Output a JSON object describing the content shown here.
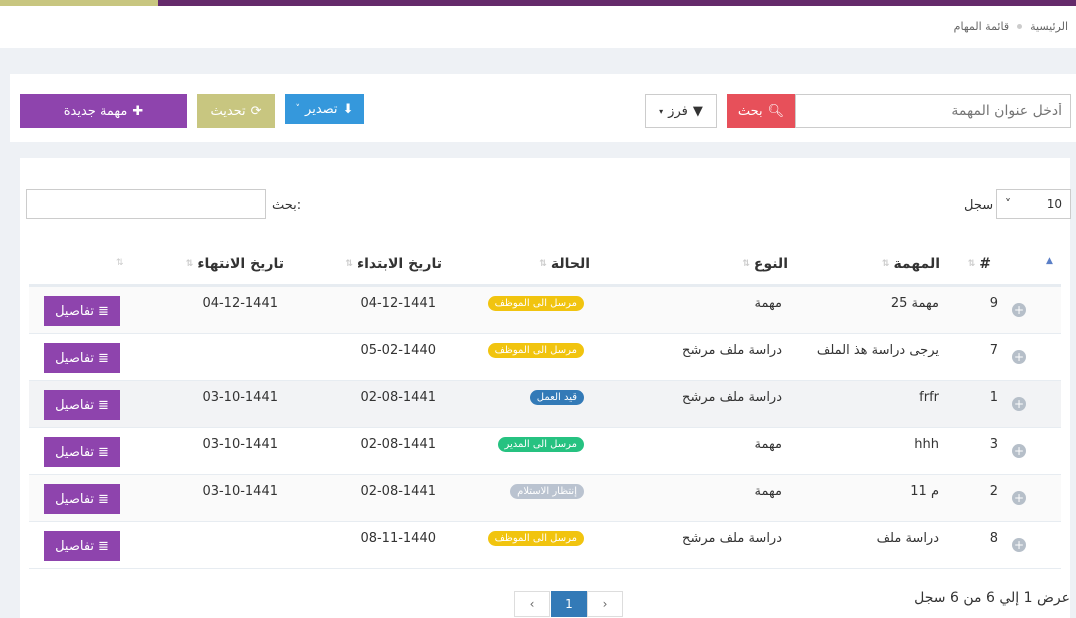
{
  "breadcrumb": [
    "الرئيسية",
    "قائمة المهام"
  ],
  "toolbar": {
    "search_placeholder": "أدخل عنوان المهمة",
    "search_btn": "بحث",
    "sort_btn": "فرز",
    "export_btn": "تصدير",
    "refresh_btn": "تحديث",
    "new_btn": "مهمة جديدة"
  },
  "table_controls": {
    "length_value": "10",
    "length_label": "سجل",
    "search_label": "بحث:"
  },
  "columns": [
    "#",
    "المهمة",
    "النوع",
    "الحالة",
    "تاريخ الابتداء",
    "تاريخ الانتهاء"
  ],
  "details_label": "تفاصيل",
  "rows": [
    {
      "id": "9",
      "task": "مهمة 25",
      "type": "مهمة",
      "status": "مرسل الى الموظف",
      "status_color": "#f1c40f",
      "start": "04-12-1441",
      "end": "04-12-1441"
    },
    {
      "id": "7",
      "task": "يرجى دراسة هذ الملف",
      "type": "دراسة ملف مرشح",
      "status": "مرسل الى الموظف",
      "status_color": "#f1c40f",
      "start": "05-02-1440",
      "end": ""
    },
    {
      "id": "1",
      "task": "frfr",
      "type": "دراسة ملف مرشح",
      "status": "قيد العمل",
      "status_color": "#337ab7",
      "start": "02-08-1441",
      "end": "03-10-1441"
    },
    {
      "id": "3",
      "task": "hhh",
      "type": "مهمة",
      "status": "مرسل الى المدير",
      "status_color": "#26c281",
      "start": "02-08-1441",
      "end": "03-10-1441"
    },
    {
      "id": "2",
      "task": "م 11",
      "type": "مهمة",
      "status": "إنتظار الاستلام",
      "status_color": "#bac3d0",
      "start": "02-08-1441",
      "end": "03-10-1441"
    },
    {
      "id": "8",
      "task": "دراسة ملف",
      "type": "دراسة ملف مرشح",
      "status": "مرسل الى الموظف",
      "status_color": "#f1c40f",
      "start": "08-11-1440",
      "end": ""
    }
  ],
  "footer": {
    "info": "عرض 1 إلي 6 من 6 سجل",
    "pages": [
      "‹",
      "1",
      "›"
    ],
    "active_page": "1"
  }
}
